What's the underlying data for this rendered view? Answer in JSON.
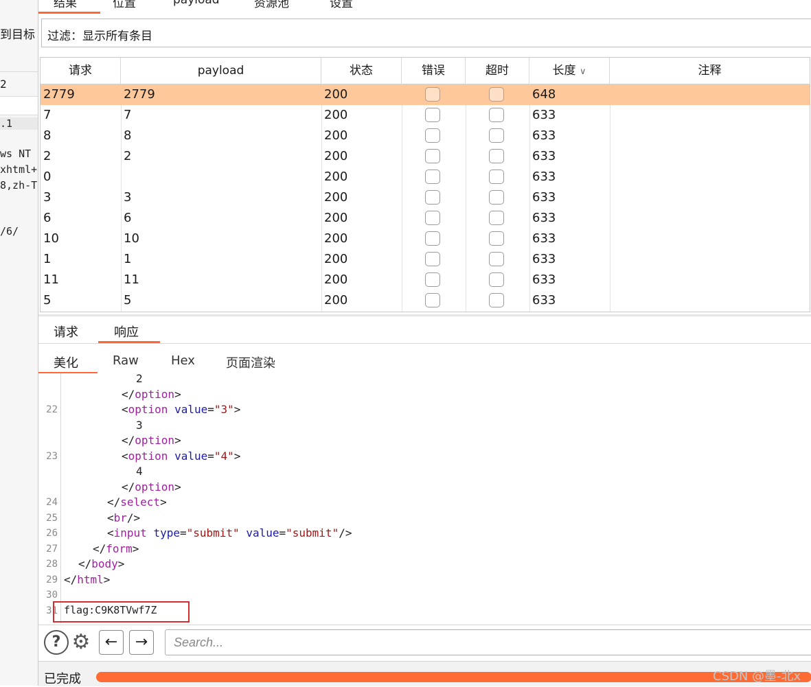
{
  "left_pane": {
    "title": "到目标",
    "num": "2",
    "code_lines": [
      ".1",
      "ws NT",
      "xhtml+",
      "8,zh-T",
      "/6/"
    ]
  },
  "result_tabs": [
    "结果",
    "位置",
    "payload",
    "资源池",
    "设置"
  ],
  "filter": {
    "text": "过滤：显示所有条目"
  },
  "table": {
    "columns": [
      "请求",
      "payload",
      "状态",
      "错误",
      "超时",
      "长度",
      "注释"
    ],
    "sort_indicator": "∨",
    "rows": [
      {
        "request": "2779",
        "payload": "2779",
        "status": "200",
        "length": "648"
      },
      {
        "request": "7",
        "payload": "7",
        "status": "200",
        "length": "633"
      },
      {
        "request": "8",
        "payload": "8",
        "status": "200",
        "length": "633"
      },
      {
        "request": "2",
        "payload": "2",
        "status": "200",
        "length": "633"
      },
      {
        "request": "0",
        "payload": "",
        "status": "200",
        "length": "633"
      },
      {
        "request": "3",
        "payload": "3",
        "status": "200",
        "length": "633"
      },
      {
        "request": "6",
        "payload": "6",
        "status": "200",
        "length": "633"
      },
      {
        "request": "10",
        "payload": "10",
        "status": "200",
        "length": "633"
      },
      {
        "request": "1",
        "payload": "1",
        "status": "200",
        "length": "633"
      },
      {
        "request": "11",
        "payload": "11",
        "status": "200",
        "length": "633"
      },
      {
        "request": "5",
        "payload": "5",
        "status": "200",
        "length": "633"
      }
    ]
  },
  "detail_tabs": [
    "请求",
    "响应"
  ],
  "view_tabs": [
    "美化",
    "Raw",
    "Hex",
    "页面渲染"
  ],
  "code": {
    "line_numbers": [
      "22",
      "23",
      "24",
      "25",
      "26",
      "27",
      "28",
      "29",
      "30",
      "31"
    ],
    "t2": "2",
    "t3": "3",
    "t4": "4",
    "opt_close": "option",
    "opt": "option",
    "value_attr": "value",
    "v3": "\"3\"",
    "v4": "\"4\"",
    "select": "select",
    "br": "br",
    "input": "input",
    "type_attr": "type",
    "submit_val": "\"submit\"",
    "form": "form",
    "body": "body",
    "html": "html",
    "flag": "flag:C9K8TVwf7Z"
  },
  "search": {
    "placeholder": "Search..."
  },
  "status": {
    "text": "已完成",
    "progress": 1.0
  },
  "watermark": "CSDN @墨-北x",
  "colors": {
    "accent": "#ff6633",
    "selected_row": "#ffc89a",
    "tag": "#a020a0",
    "attr": "#1a1aa6",
    "string": "#a31515",
    "flag_box": "#d42d2d"
  }
}
